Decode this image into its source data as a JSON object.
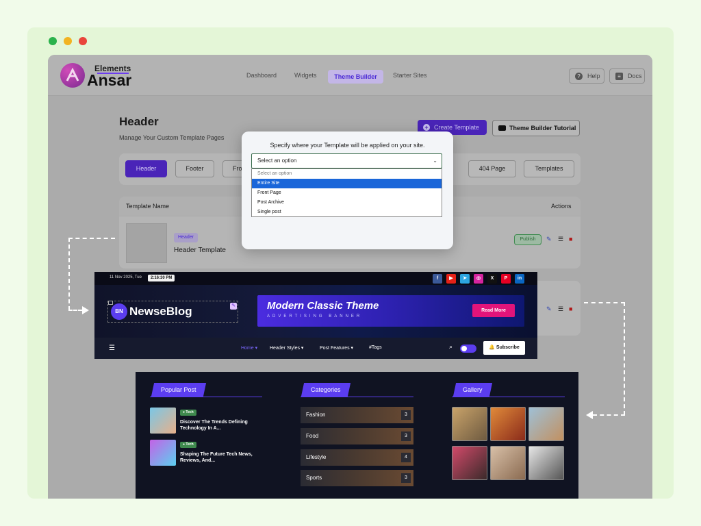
{
  "app": {
    "logo_top": "Elements",
    "logo_main": "Ansar",
    "nav": [
      "Dashboard",
      "Widgets",
      "Theme Builder",
      "Starter Sites"
    ],
    "active_nav": "Theme Builder",
    "help_label": "Help",
    "docs_label": "Docs"
  },
  "page": {
    "title": "Header",
    "subtitle": "Manage Your Custom Template Pages",
    "create_label": "Create Template",
    "tutorial_label": "Theme Builder Tutorial"
  },
  "tabs": [
    "Header",
    "Footer",
    "Fro",
    "404 Page",
    "Templates"
  ],
  "table": {
    "col_name": "Template Name",
    "col_actions": "Actions",
    "row": {
      "badge": "Header",
      "name": "Header Template",
      "status": "Publish"
    }
  },
  "modal": {
    "question": "Specify where your Template will be applied on your site.",
    "selected": "Select an option",
    "options": [
      "Select an option",
      "Entire Site",
      "Front Page",
      "Post Archive",
      "Single post"
    ],
    "highlighted": "Entire Site"
  },
  "newse": {
    "date": "11 Nov 2025, Tue",
    "time": "2:16:30 PM",
    "social": [
      {
        "icon": "f",
        "color": "#3b5998"
      },
      {
        "icon": "▶",
        "color": "#e62117"
      },
      {
        "icon": "➤",
        "color": "#2ca5e0"
      },
      {
        "icon": "◎",
        "color": "#d6249f"
      },
      {
        "icon": "X",
        "color": "#111111"
      },
      {
        "icon": "P",
        "color": "#e60023"
      },
      {
        "icon": "in",
        "color": "#0a66c2"
      }
    ],
    "logo_mark": "BN",
    "logo_name": "NewseBlog",
    "banner_title": "Modern Classic Theme",
    "banner_sub": "ADVERTISING BANNER",
    "read_more": "Read More",
    "menu": [
      "Home ▾",
      "Header Styles ▾",
      "Post Features ▾",
      "#Tags"
    ],
    "subscribe": "Subscribe"
  },
  "footer": {
    "popular": "Popular Post",
    "categories": "Categories",
    "gallery": "Gallery",
    "posts": [
      {
        "tag": "● Tech",
        "title": "Discover The Trends Defining Technology In A..."
      },
      {
        "tag": "● Tech",
        "title": "Shaping The Future Tech News, Reviews, And..."
      }
    ],
    "cats": [
      {
        "name": "Fashion",
        "count": "3"
      },
      {
        "name": "Food",
        "count": "3"
      },
      {
        "name": "Lifestyle",
        "count": "4"
      },
      {
        "name": "Sports",
        "count": "3"
      }
    ]
  }
}
